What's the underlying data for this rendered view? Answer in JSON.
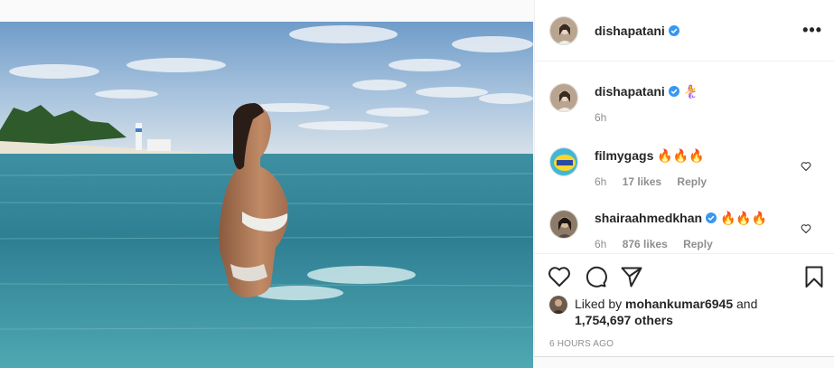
{
  "post": {
    "username": "dishapatani",
    "more_label": "•••"
  },
  "comments": [
    {
      "username": "dishapatani",
      "text": "🧜‍♀️",
      "time": "6h",
      "likes": "",
      "reply": ""
    },
    {
      "username": "filmygags",
      "text": "🔥🔥🔥",
      "time": "6h",
      "likes": "17 likes",
      "reply": "Reply"
    },
    {
      "username": "shairaahmedkhan",
      "text": "🔥🔥🔥",
      "time": "6h",
      "likes": "876 likes",
      "reply": "Reply"
    }
  ],
  "likes": {
    "prefix": "Liked by",
    "user": "mohankumar6945",
    "and": "and",
    "count": "1,754,697 others"
  },
  "timestamp": "6 HOURS AGO",
  "icons": [
    "heart-icon",
    "comment-icon",
    "share-icon",
    "bookmark-icon",
    "verified-icon",
    "more-icon"
  ],
  "colors": {
    "verified": "#3897f0",
    "text": "#262626",
    "muted": "#8e8e8e"
  }
}
